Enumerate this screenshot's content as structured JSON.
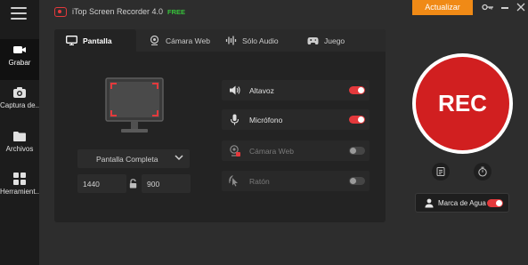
{
  "app": {
    "title": "iTop Screen Recorder 4.0",
    "badge": "FREE",
    "upgrade_label": "Actualizar",
    "accent_color": "#e4393c",
    "upgrade_color": "#f08a16"
  },
  "sidebar": {
    "items": [
      {
        "label": "Grabar",
        "icon": "camera-icon",
        "active": true
      },
      {
        "label": "Captura de...",
        "icon": "photo-camera-icon",
        "active": false
      },
      {
        "label": "Archivos",
        "icon": "folder-icon",
        "active": false
      },
      {
        "label": "Herramient...",
        "icon": "grid-icon",
        "active": false
      }
    ]
  },
  "tabs": [
    {
      "label": "Pantalla",
      "icon": "monitor-icon",
      "active": true
    },
    {
      "label": "Cámara Web",
      "icon": "webcam-icon",
      "active": false
    },
    {
      "label": "Sólo Audio",
      "icon": "audio-wave-icon",
      "active": false
    },
    {
      "label": "Juego",
      "icon": "gamepad-icon",
      "active": false
    }
  ],
  "screen": {
    "mode": "Pantalla Completa",
    "width": "1440",
    "height": "900"
  },
  "options": [
    {
      "label": "Altavoz",
      "icon": "speaker-icon",
      "enabled": true,
      "on": true
    },
    {
      "label": "Micrófono",
      "icon": "microphone-icon",
      "enabled": true,
      "on": true
    },
    {
      "label": "Cámara Web",
      "icon": "webcam-icon",
      "enabled": false,
      "on": false
    },
    {
      "label": "Ratón",
      "icon": "mouse-icon",
      "enabled": false,
      "on": false
    }
  ],
  "rec": {
    "label": "REC"
  },
  "watermark": {
    "label": "Marca de Agua",
    "on": true
  }
}
